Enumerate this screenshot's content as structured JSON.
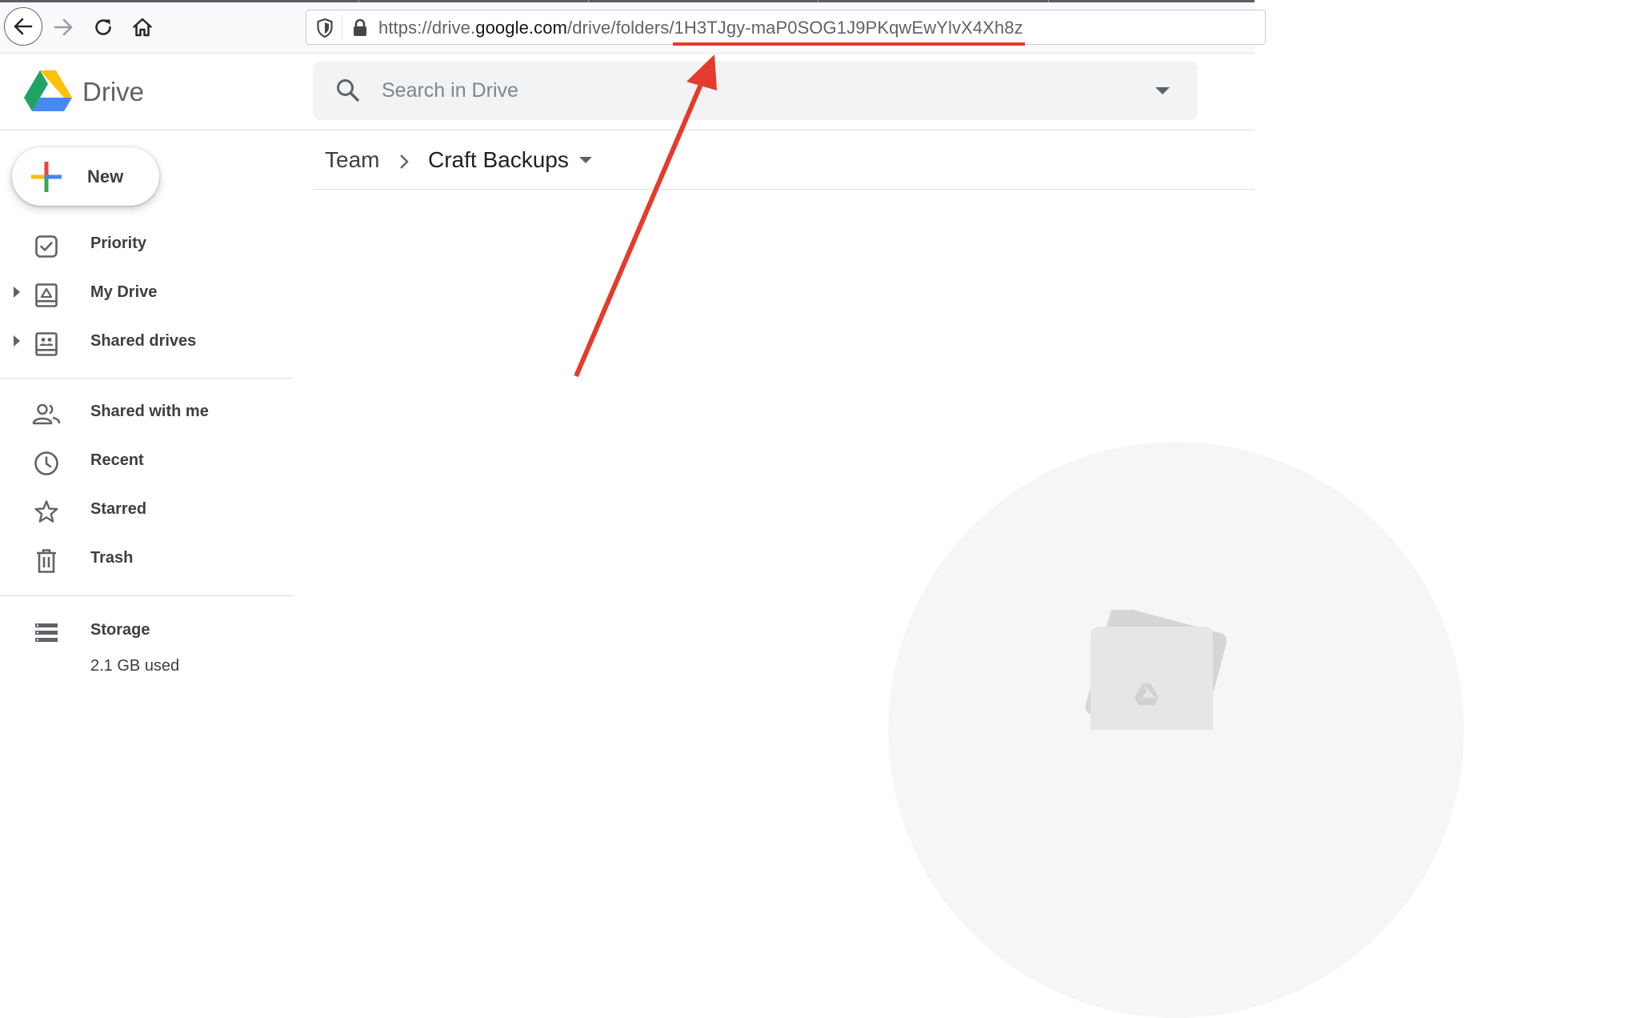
{
  "browser": {
    "url_prefix": "https://drive.",
    "url_domain": "google.com",
    "url_path": "/drive/folders/",
    "url_folder_id": "1H3TJgy-maP0SOG1J9PKqwEwYlvX4Xh8z"
  },
  "header": {
    "app_title": "Drive",
    "search_placeholder": "Search in Drive"
  },
  "sidebar": {
    "new_label": "New",
    "items": [
      {
        "label": "Priority",
        "icon": "checkbox-icon"
      },
      {
        "label": "My Drive",
        "icon": "my-drive-icon"
      },
      {
        "label": "Shared drives",
        "icon": "shared-drives-icon"
      },
      {
        "label": "Shared with me",
        "icon": "people-icon"
      },
      {
        "label": "Recent",
        "icon": "clock-icon"
      },
      {
        "label": "Starred",
        "icon": "star-icon"
      },
      {
        "label": "Trash",
        "icon": "trash-icon"
      },
      {
        "label": "Storage",
        "icon": "storage-icon"
      }
    ],
    "storage_used": "2.1 GB used"
  },
  "main": {
    "breadcrumb": [
      "Team",
      "Craft Backups"
    ]
  },
  "colors": {
    "annotation_red": "#e53b2c",
    "drive_green": "#1fa463",
    "drive_yellow": "#ffd04b",
    "drive_blue": "#4688f4"
  }
}
